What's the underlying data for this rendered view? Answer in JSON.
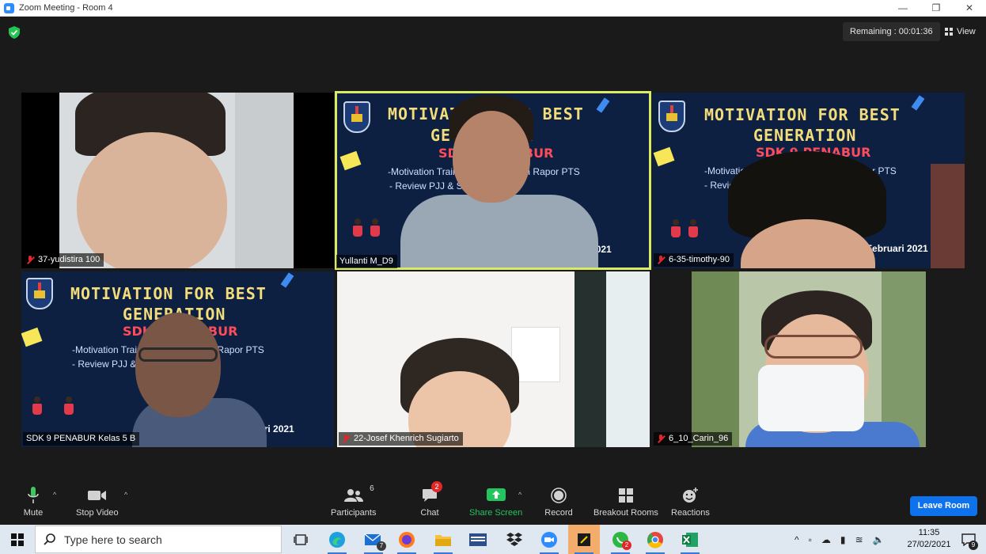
{
  "window": {
    "title": "Zoom Meeting - Room 4"
  },
  "meeting": {
    "remaining": "Remaining : 00:01:36",
    "view_label": "View"
  },
  "slide": {
    "title1": "MOTIVATION FOR BEST",
    "title2": "GENERATION",
    "title3": "SDK 9 PENABUR",
    "bullet1": "-Motivation Training & Pembagian Rapor PTS",
    "bullet2": "- Review PJJ & Sosialisasi US",
    "date": "Sabtu, 27 Februari 2021"
  },
  "participants": [
    {
      "name": "37-yudistira 100",
      "muted": true
    },
    {
      "name": "Yullanti M_D9",
      "muted": false,
      "active": true
    },
    {
      "name": "6-35-timothy-90",
      "muted": true
    },
    {
      "name": "SDK 9 PENABUR Kelas 5 B",
      "muted": false
    },
    {
      "name": "22-Josef Khenrich Sugiarto",
      "muted": true
    },
    {
      "name": "6_10_Carin_96",
      "muted": true
    }
  ],
  "toolbar": {
    "mute": "Mute",
    "stop_video": "Stop Video",
    "participants": "Participants",
    "participants_count": "6",
    "chat": "Chat",
    "chat_badge": "2",
    "share_screen": "Share Screen",
    "record": "Record",
    "breakout_rooms": "Breakout Rooms",
    "reactions": "Reactions",
    "leave": "Leave Room"
  },
  "taskbar": {
    "search_placeholder": "Type here to search",
    "mail_badge": "7",
    "whatsapp_badge": "2",
    "time": "11:35",
    "date": "27/02/2021",
    "notifications": "9"
  },
  "colors": {
    "accent": "#0e72ed",
    "active_speaker": "#d9ea63",
    "share_green": "#22c55e",
    "slide_bg": "#0d2042"
  }
}
